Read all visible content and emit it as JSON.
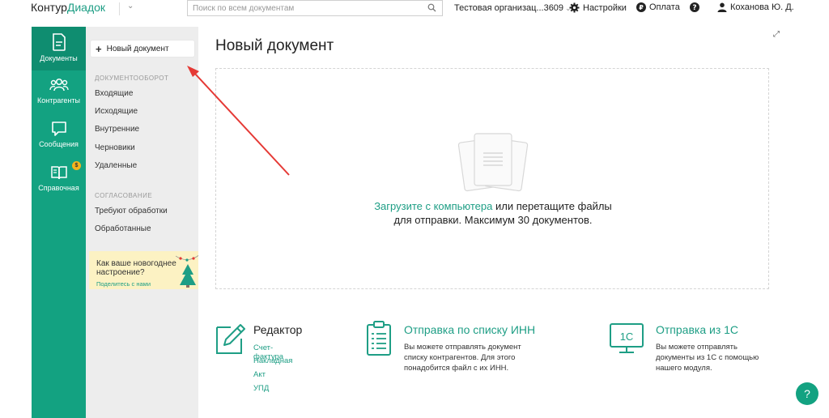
{
  "header": {
    "logo_part1": "Контур",
    "logo_part2": "Диадок",
    "search_placeholder": "Поиск по всем документам",
    "organization": "Тестовая организац...3609",
    "settings": "Настройки",
    "payment": "Оплата",
    "user": "Коханова Ю. Д."
  },
  "rail": {
    "items": [
      {
        "label": "Документы",
        "icon": "document-icon"
      },
      {
        "label": "Контрагенты",
        "icon": "users-icon"
      },
      {
        "label": "Сообщения",
        "icon": "chat-icon"
      },
      {
        "label": "Справочная",
        "icon": "book-icon",
        "badge": "$"
      }
    ]
  },
  "sidebar": {
    "new_document": "Новый документ",
    "section1_title": "ДОКУМЕНТООБОРОТ",
    "section1_items": [
      "Входящие",
      "Исходящие",
      "Внутренние",
      "Черновики",
      "Удаленные"
    ],
    "section2_title": "СОГЛАСОВАНИЕ",
    "section2_items": [
      "Требуют обработки",
      "Обработанные"
    ],
    "promo_text": "Как ваше новогоднее настроение?",
    "promo_link": "Поделитесь с нами"
  },
  "main": {
    "title": "Новый документ",
    "upload_link": "Загрузите с компьютера",
    "upload_rest": " или перетащите файлы",
    "upload_line2": "для отправки. Максимум 30 документов.",
    "features": [
      {
        "title": "Редактор",
        "links": [
          "Счет-фактура",
          "Накладная",
          "Акт",
          "УПД"
        ]
      },
      {
        "title": "Отправка по списку ИНН",
        "desc": "Вы можете отправлять документ списку контрагентов. Для этого понадобится файл с их ИНН."
      },
      {
        "title": "Отправка из 1С",
        "desc": "Вы можете отправлять документы из 1С с помощью нашего модуля.",
        "icon_text": "1С"
      }
    ],
    "help": "?"
  },
  "colors": {
    "accent": "#13a281",
    "link": "#1e9e85",
    "arrow": "#e53935",
    "sidebar": "#ededed"
  }
}
